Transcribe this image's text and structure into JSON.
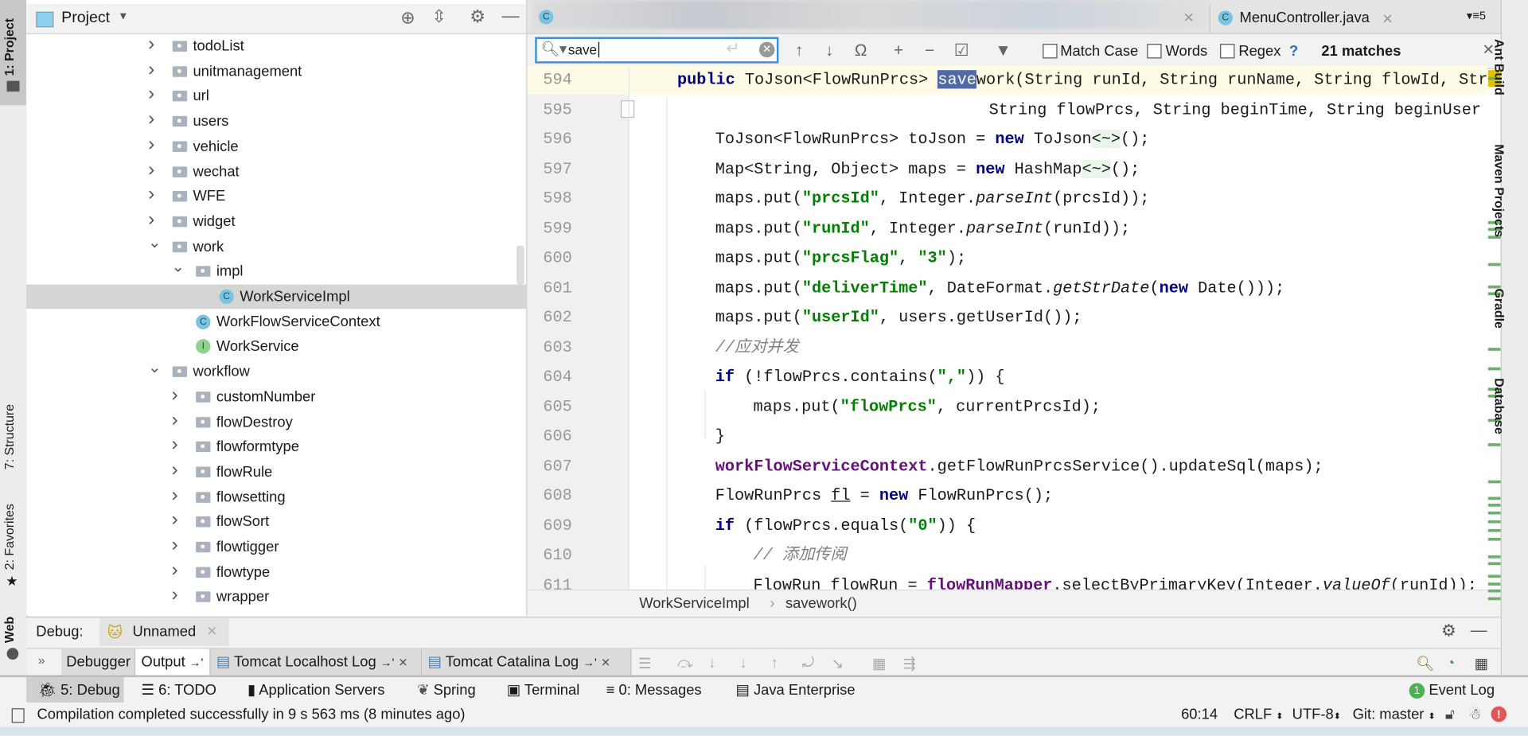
{
  "left_strip": {
    "project": "1: Project",
    "structure": "7: Structure",
    "favorites": "2: Favorites",
    "web": "Web"
  },
  "right_strip": {
    "ant": "Ant Build",
    "maven": "Maven Projects",
    "gradle": "Gradle",
    "database": "Database"
  },
  "project_panel": {
    "title": "Project",
    "tree": [
      {
        "label": "todoList",
        "type": "folder",
        "depth": 0,
        "expanded": false
      },
      {
        "label": "unitmanagement",
        "type": "folder",
        "depth": 0,
        "expanded": false
      },
      {
        "label": "url",
        "type": "folder",
        "depth": 0,
        "expanded": false
      },
      {
        "label": "users",
        "type": "folder",
        "depth": 0,
        "expanded": false
      },
      {
        "label": "vehicle",
        "type": "folder",
        "depth": 0,
        "expanded": false
      },
      {
        "label": "wechat",
        "type": "folder",
        "depth": 0,
        "expanded": false
      },
      {
        "label": "WFE",
        "type": "folder",
        "depth": 0,
        "expanded": false
      },
      {
        "label": "widget",
        "type": "folder",
        "depth": 0,
        "expanded": false
      },
      {
        "label": "work",
        "type": "folder",
        "depth": 0,
        "expanded": true
      },
      {
        "label": "impl",
        "type": "folder",
        "depth": 1,
        "expanded": true
      },
      {
        "label": "WorkServiceImpl",
        "type": "class",
        "depth": 2,
        "selected": true
      },
      {
        "label": "WorkFlowServiceContext",
        "type": "class",
        "depth": 1
      },
      {
        "label": "WorkService",
        "type": "interface",
        "depth": 1
      },
      {
        "label": "workflow",
        "type": "folder",
        "depth": 0,
        "expanded": true
      },
      {
        "label": "customNumber",
        "type": "folder",
        "depth": 1,
        "expanded": false
      },
      {
        "label": "flowDestroy",
        "type": "folder",
        "depth": 1,
        "expanded": false
      },
      {
        "label": "flowformtype",
        "type": "folder",
        "depth": 1,
        "expanded": false
      },
      {
        "label": "flowRule",
        "type": "folder",
        "depth": 1,
        "expanded": false
      },
      {
        "label": "flowsetting",
        "type": "folder",
        "depth": 1,
        "expanded": false
      },
      {
        "label": "flowSort",
        "type": "folder",
        "depth": 1,
        "expanded": false
      },
      {
        "label": "flowtigger",
        "type": "folder",
        "depth": 1,
        "expanded": false
      },
      {
        "label": "flowtype",
        "type": "folder",
        "depth": 1,
        "expanded": false
      },
      {
        "label": "wrapper",
        "type": "folder",
        "depth": 1,
        "expanded": false
      }
    ]
  },
  "editor": {
    "tabs": [
      {
        "label": "MenuController.java",
        "icon": "class-icon"
      }
    ],
    "tab_count": "5",
    "find": {
      "value": "save",
      "match_case": "Match Case",
      "words": "Words",
      "regex": "Regex",
      "help": "?",
      "matches": "21 matches"
    },
    "lines": [
      {
        "n": "594",
        "indent": 1,
        "cur": true,
        "t": [
          [
            "public ",
            "kw"
          ],
          [
            "ToJson<FlowRunPrcs> ",
            ""
          ],
          [
            "save",
            "hl"
          ],
          [
            "work(String runId, String runName, String flowId, Stri",
            ""
          ]
        ]
      },
      {
        "n": "595",
        "indent": 9.2,
        "t": [
          [
            "String flowPrcs, String beginTime, String beginUser",
            ""
          ]
        ]
      },
      {
        "n": "596",
        "indent": 2,
        "t": [
          [
            "ToJson<FlowRunPrcs> toJson = ",
            ""
          ],
          [
            "new ",
            "kw"
          ],
          [
            "ToJson",
            ""
          ],
          [
            "<~>",
            "dia"
          ],
          [
            "();",
            ""
          ]
        ]
      },
      {
        "n": "597",
        "indent": 2,
        "t": [
          [
            "Map<String, Object> maps = ",
            ""
          ],
          [
            "new ",
            "kw"
          ],
          [
            "HashMap",
            ""
          ],
          [
            "<~>",
            "dia"
          ],
          [
            "();",
            ""
          ]
        ]
      },
      {
        "n": "598",
        "indent": 2,
        "t": [
          [
            "maps.put(",
            ""
          ],
          [
            "\"prcsId\"",
            "str"
          ],
          [
            ", Integer.",
            ""
          ],
          [
            "parseInt",
            "it"
          ],
          [
            "(prcsId));",
            ""
          ]
        ]
      },
      {
        "n": "599",
        "indent": 2,
        "t": [
          [
            "maps.put(",
            ""
          ],
          [
            "\"runId\"",
            "str"
          ],
          [
            ", Integer.",
            ""
          ],
          [
            "parseInt",
            "it"
          ],
          [
            "(runId));",
            ""
          ]
        ]
      },
      {
        "n": "600",
        "indent": 2,
        "t": [
          [
            "maps.put(",
            ""
          ],
          [
            "\"prcsFlag\"",
            "str"
          ],
          [
            ", ",
            ""
          ],
          [
            "\"3\"",
            "str"
          ],
          [
            ");",
            ""
          ]
        ]
      },
      {
        "n": "601",
        "indent": 2,
        "t": [
          [
            "maps.put(",
            ""
          ],
          [
            "\"deliverTime\"",
            "str"
          ],
          [
            ", DateFormat.",
            ""
          ],
          [
            "getStrDate",
            "it"
          ],
          [
            "(",
            ""
          ],
          [
            "new ",
            "kw"
          ],
          [
            "Date()));",
            ""
          ]
        ]
      },
      {
        "n": "602",
        "indent": 2,
        "t": [
          [
            "maps.put(",
            ""
          ],
          [
            "\"userId\"",
            "str"
          ],
          [
            ", users.getUserId());",
            ""
          ]
        ]
      },
      {
        "n": "603",
        "indent": 2,
        "t": [
          [
            "//应对并发",
            "cm"
          ]
        ]
      },
      {
        "n": "604",
        "indent": 2,
        "t": [
          [
            "if ",
            "kw"
          ],
          [
            "(!flowPrcs.contains(",
            ""
          ],
          [
            "\",\"",
            "str"
          ],
          [
            ")) {",
            ""
          ]
        ]
      },
      {
        "n": "605",
        "indent": 3,
        "t": [
          [
            "maps.put(",
            ""
          ],
          [
            "\"flowPrcs\"",
            "str"
          ],
          [
            ", currentPrcsId);",
            ""
          ]
        ]
      },
      {
        "n": "606",
        "indent": 2,
        "t": [
          [
            "}",
            ""
          ]
        ]
      },
      {
        "n": "607",
        "indent": 2,
        "t": [
          [
            "workFlowServiceContext",
            "fld"
          ],
          [
            ".getFlowRunPrcsService().updateSql(maps);",
            ""
          ]
        ]
      },
      {
        "n": "608",
        "indent": 2,
        "t": [
          [
            "FlowRunPrcs ",
            ""
          ],
          [
            "fl",
            "ul"
          ],
          [
            " = ",
            ""
          ],
          [
            "new ",
            "kw"
          ],
          [
            "FlowRunPrcs();",
            ""
          ]
        ]
      },
      {
        "n": "609",
        "indent": 2,
        "t": [
          [
            "if ",
            "kw"
          ],
          [
            "(flowPrcs.equals(",
            ""
          ],
          [
            "\"0\"",
            "str"
          ],
          [
            ")) {",
            ""
          ]
        ]
      },
      {
        "n": "610",
        "indent": 3,
        "t": [
          [
            "// 添加传阅",
            "cm"
          ]
        ]
      },
      {
        "n": "611",
        "indent": 3,
        "t": [
          [
            "FlowRun flowRun = ",
            ""
          ],
          [
            "flowRunMapper",
            "fld"
          ],
          [
            ".selectByPrimaryKey(Integer.",
            ""
          ],
          [
            "valueOf",
            "it"
          ],
          [
            "(runId));",
            ""
          ]
        ]
      }
    ],
    "breadcrumb": [
      "WorkServiceImpl",
      "savework()"
    ]
  },
  "debug": {
    "label": "Debug:",
    "session": "Unnamed",
    "tabs": [
      "Debugger",
      "Output",
      "Tomcat Localhost Log",
      "Tomcat Catalina Log"
    ]
  },
  "tool_windows": [
    "5: Debug",
    "6: TODO",
    "Application Servers",
    "Spring",
    "Terminal",
    "0: Messages",
    "Java Enterprise"
  ],
  "event_log": {
    "label": "Event Log",
    "count": "1"
  },
  "status": {
    "message": "Compilation completed successfully in 9 s 563 ms (8 minutes ago)",
    "position": "60:14",
    "line_sep": "CRLF",
    "encoding": "UTF-8",
    "vcs": "Git: master"
  }
}
